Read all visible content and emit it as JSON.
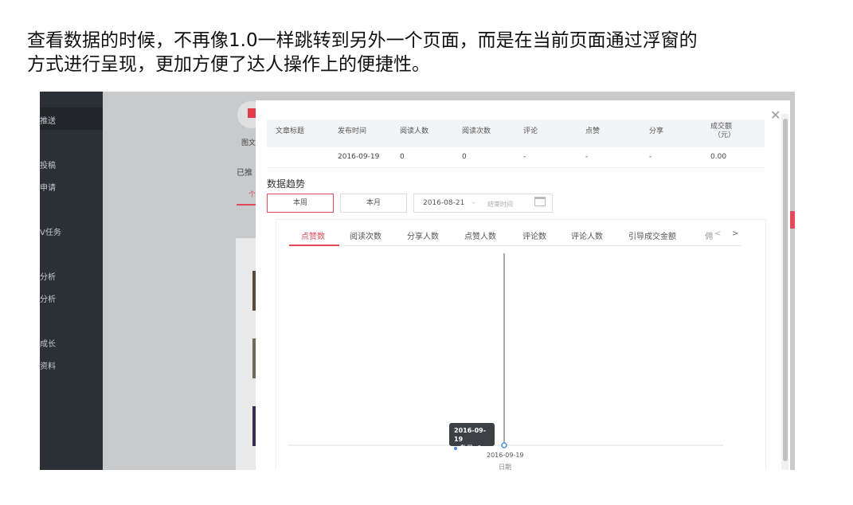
{
  "caption": {
    "line1": "查看数据的时候，不再像1.0一样跳转到另外一个页面，而是在当前页面通过浮窗的",
    "line2": "方式进行呈现，更加方便了达人操作上的便捷性。"
  },
  "sidebar": {
    "items": [
      "推送",
      "投稿",
      "申请",
      "V任务",
      "分析",
      "分析",
      "成长",
      "资料"
    ]
  },
  "background": {
    "icon_label": "图文",
    "section_label": "已推",
    "tab_label": "个"
  },
  "table": {
    "headers": [
      "文章标题",
      "发布时间",
      "阅读人数",
      "阅读次数",
      "评论",
      "点赞",
      "分享",
      "成交额"
    ],
    "header_unit": "（元）",
    "row": [
      "",
      "2016-09-19",
      "0",
      "0",
      "-",
      "-",
      "-",
      "0.00"
    ]
  },
  "trend": {
    "title": "数据趋势",
    "period_buttons": [
      "本周",
      "本月"
    ],
    "start_date": "2016-08-21",
    "separator": "-",
    "end_placeholder": "结束时间"
  },
  "metric_tabs": [
    "点赞数",
    "阅读次数",
    "分享人数",
    "点赞人数",
    "评论数",
    "评论人数",
    "引导成交金额",
    "佣"
  ],
  "tab_nav": {
    "prev": "<",
    "next": ">"
  },
  "chart_data": {
    "type": "line",
    "x": [
      "2016-09-19"
    ],
    "series": [
      {
        "name": "数量",
        "values": [
          0
        ]
      }
    ],
    "xlabel": "日期",
    "tooltip": {
      "date": "2016-09-19",
      "label": "数量",
      "value": "0"
    }
  },
  "colors": {
    "accent": "#e24a5a",
    "point": "#4a90e2",
    "sidebar": "#2b2f36"
  },
  "icons": {
    "close": "close-icon",
    "calendar": "calendar-icon"
  }
}
